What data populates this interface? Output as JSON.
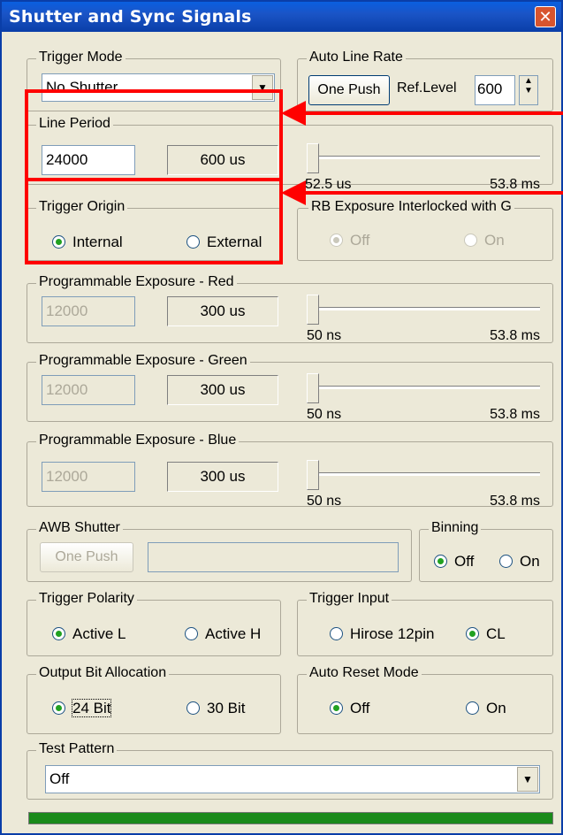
{
  "window": {
    "title": "Shutter and Sync Signals"
  },
  "colors": {
    "highlight": "#ff0000",
    "progress": "#1a8a1a",
    "titlebar": "#0a3ea8"
  },
  "trigger_mode": {
    "legend": "Trigger Mode",
    "value": "No Shutter"
  },
  "auto_line_rate": {
    "legend": "Auto Line Rate",
    "button": "One Push",
    "ref_label": "Ref.Level",
    "ref_value": "600"
  },
  "line_period": {
    "legend": "Line Period",
    "value": "24000",
    "readout": "600 us",
    "min": "52.5 us",
    "max": "53.8 ms"
  },
  "trigger_origin": {
    "legend": "Trigger Origin",
    "opt1": "Internal",
    "opt2": "External"
  },
  "rb_exposure": {
    "legend": "RB Exposure Interlocked with G",
    "opt1": "Off",
    "opt2": "On"
  },
  "exp_red": {
    "legend": "Programmable Exposure - Red",
    "value": "12000",
    "readout": "300 us",
    "min": "50 ns",
    "max": "53.8 ms"
  },
  "exp_green": {
    "legend": "Programmable Exposure - Green",
    "value": "12000",
    "readout": "300 us",
    "min": "50 ns",
    "max": "53.8 ms"
  },
  "exp_blue": {
    "legend": "Programmable Exposure - Blue",
    "value": "12000",
    "readout": "300 us",
    "min": "50 ns",
    "max": "53.8 ms"
  },
  "awb": {
    "legend": "AWB Shutter",
    "button": "One Push"
  },
  "binning": {
    "legend": "Binning",
    "opt1": "Off",
    "opt2": "On"
  },
  "trigger_polarity": {
    "legend": "Trigger Polarity",
    "opt1": "Active L",
    "opt2": "Active H"
  },
  "trigger_input": {
    "legend": "Trigger Input",
    "opt1": "Hirose 12pin",
    "opt2": "CL"
  },
  "output_bit": {
    "legend": "Output Bit Allocation",
    "opt1": "24 Bit",
    "opt2": "30 Bit"
  },
  "auto_reset": {
    "legend": "Auto Reset Mode",
    "opt1": "Off",
    "opt2": "On"
  },
  "test_pattern": {
    "legend": "Test Pattern",
    "value": "Off"
  }
}
